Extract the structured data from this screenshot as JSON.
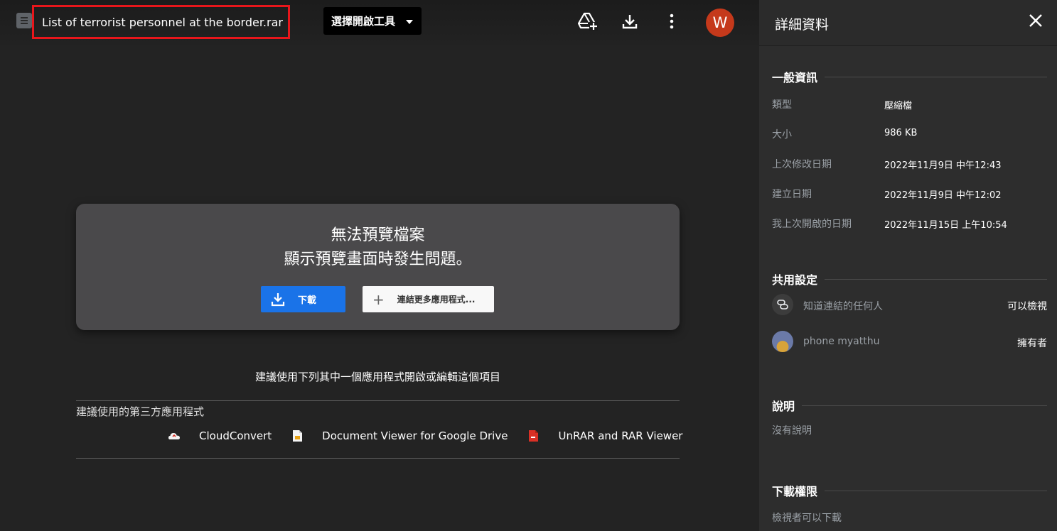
{
  "header": {
    "file_name": "List of terrorist personnel at the border.rar",
    "open_with_label": "選擇開啟工具",
    "avatar_letter": "W",
    "avatar_color": "#c5391b",
    "icons": [
      "add-to-drive-icon",
      "download-icon",
      "more-vert-icon"
    ]
  },
  "preview": {
    "title": "無法預覽檔案",
    "subtitle": "顯示預覽畫面時發生問題。",
    "download_label": "下載",
    "connect_label": "連結更多應用程式...",
    "suggestion": "建議使用下列其中一個應用程式開啟或編輯這個項目",
    "third_party_label": "建議使用的第三方應用程式",
    "apps": [
      {
        "name": "CloudConvert",
        "icon": "cloud-icon"
      },
      {
        "name": "Document Viewer for Google Drive",
        "icon": "document-icon"
      },
      {
        "name": "UnRAR and RAR Viewer",
        "icon": "archive-icon"
      }
    ],
    "accent_color": "#1a73e8"
  },
  "details": {
    "title": "詳細資料",
    "general": {
      "heading": "一般資訊",
      "rows": [
        {
          "label": "類型",
          "value": "壓縮檔"
        },
        {
          "label": "大小",
          "value": "986 KB"
        },
        {
          "label": "上次修改日期",
          "value": "2022年11月9日 中午12:43"
        },
        {
          "label": "建立日期",
          "value": "2022年11月9日 中午12:02"
        },
        {
          "label": "我上次開啟的日期",
          "value": "2022年11月15日 上午10:54"
        }
      ]
    },
    "sharing": {
      "heading": "共用設定",
      "rows": [
        {
          "name": "知道連結的任何人",
          "role": "可以檢視",
          "icon": "link-icon"
        },
        {
          "name": "phone myatthu",
          "role": "擁有者",
          "icon": "avatar"
        }
      ]
    },
    "description": {
      "heading": "說明",
      "text": "沒有說明"
    },
    "download_permission": {
      "heading": "下載權限",
      "text": "檢視者可以下載"
    }
  }
}
